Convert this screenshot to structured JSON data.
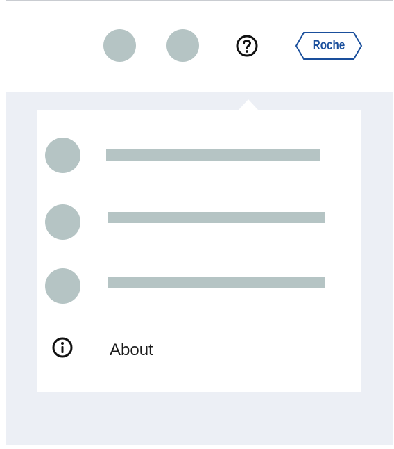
{
  "header": {
    "icons": [
      "placeholder-avatar-1",
      "placeholder-avatar-2",
      "help-icon",
      "roche-logo"
    ],
    "logo_text": "Roche"
  },
  "menu": {
    "items": [
      {
        "icon": "placeholder-circle",
        "label": ""
      },
      {
        "icon": "placeholder-circle",
        "label": ""
      },
      {
        "icon": "placeholder-circle",
        "label": ""
      },
      {
        "icon": "info-icon",
        "label": "About"
      }
    ]
  },
  "colors": {
    "placeholder": "#b5c4c4",
    "background": "#eceff5",
    "logo_blue": "#1a4f9c"
  }
}
